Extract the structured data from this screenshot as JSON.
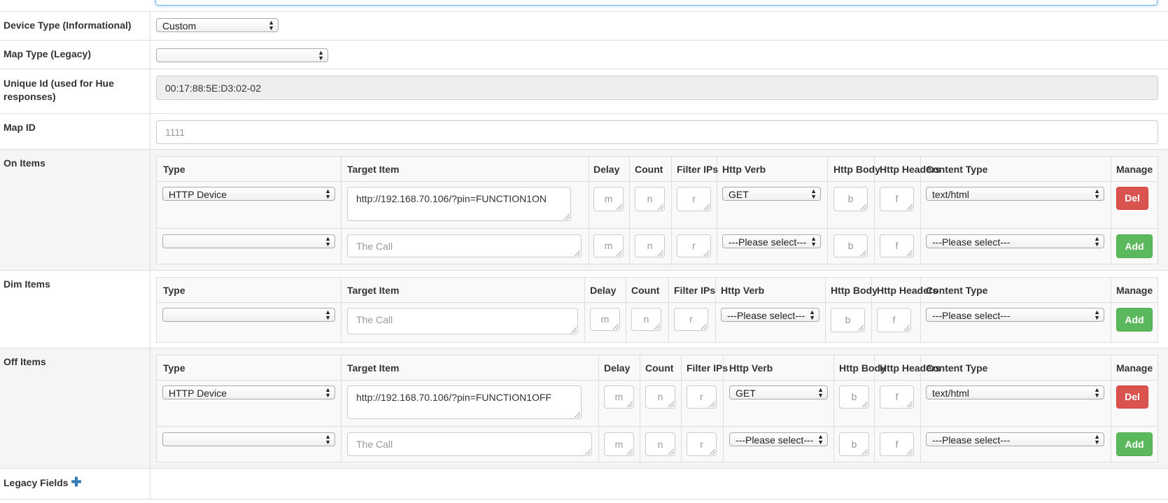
{
  "fields": {
    "device_type": {
      "label": "Device Type (Informational)",
      "value": "Custom"
    },
    "map_type": {
      "label": "Map Type (Legacy)",
      "value": ""
    },
    "unique_id": {
      "label": "Unique Id (used for Hue responses)",
      "value": "00:17:88:5E:D3:02-02"
    },
    "map_id": {
      "label": "Map ID",
      "placeholder": "1111"
    }
  },
  "headers": {
    "type": "Type",
    "target": "Target Item",
    "delay": "Delay",
    "count": "Count",
    "filter": "Filter IPs",
    "verb": "Http Verb",
    "body": "Http Body",
    "headers": "Http Headers",
    "content": "Content Type",
    "manage": "Manage"
  },
  "placeholders": {
    "call": "The Call",
    "delay": "m",
    "count": "n",
    "filter": "r",
    "body": "b",
    "headers": "f"
  },
  "on_items": {
    "label": "On Items",
    "row1": {
      "type": "HTTP Device",
      "target": "http://192.168.70.106/?pin=FUNCTION1ON",
      "verb": "GET",
      "content": "text/html",
      "button": "Del"
    },
    "row2": {
      "type": "",
      "verb": "---Please select---",
      "content": "---Please select---",
      "button": "Add"
    }
  },
  "dim_items": {
    "label": "Dim Items",
    "row1": {
      "type": "",
      "verb": "---Please select---",
      "content": "---Please select---",
      "button": "Add"
    }
  },
  "off_items": {
    "label": "Off Items",
    "row1": {
      "type": "HTTP Device",
      "target": "http://192.168.70.106/?pin=FUNCTION1OFF",
      "verb": "GET",
      "content": "text/html",
      "button": "Del"
    },
    "row2": {
      "type": "",
      "verb": "---Please select---",
      "content": "---Please select---",
      "button": "Add"
    }
  },
  "legacy": {
    "label": "Legacy Fields",
    "plus": "✚"
  },
  "colors": {
    "del": "#d9534f",
    "add": "#5cb85c",
    "focus": "#66afe9",
    "plus": "#337ab7"
  }
}
